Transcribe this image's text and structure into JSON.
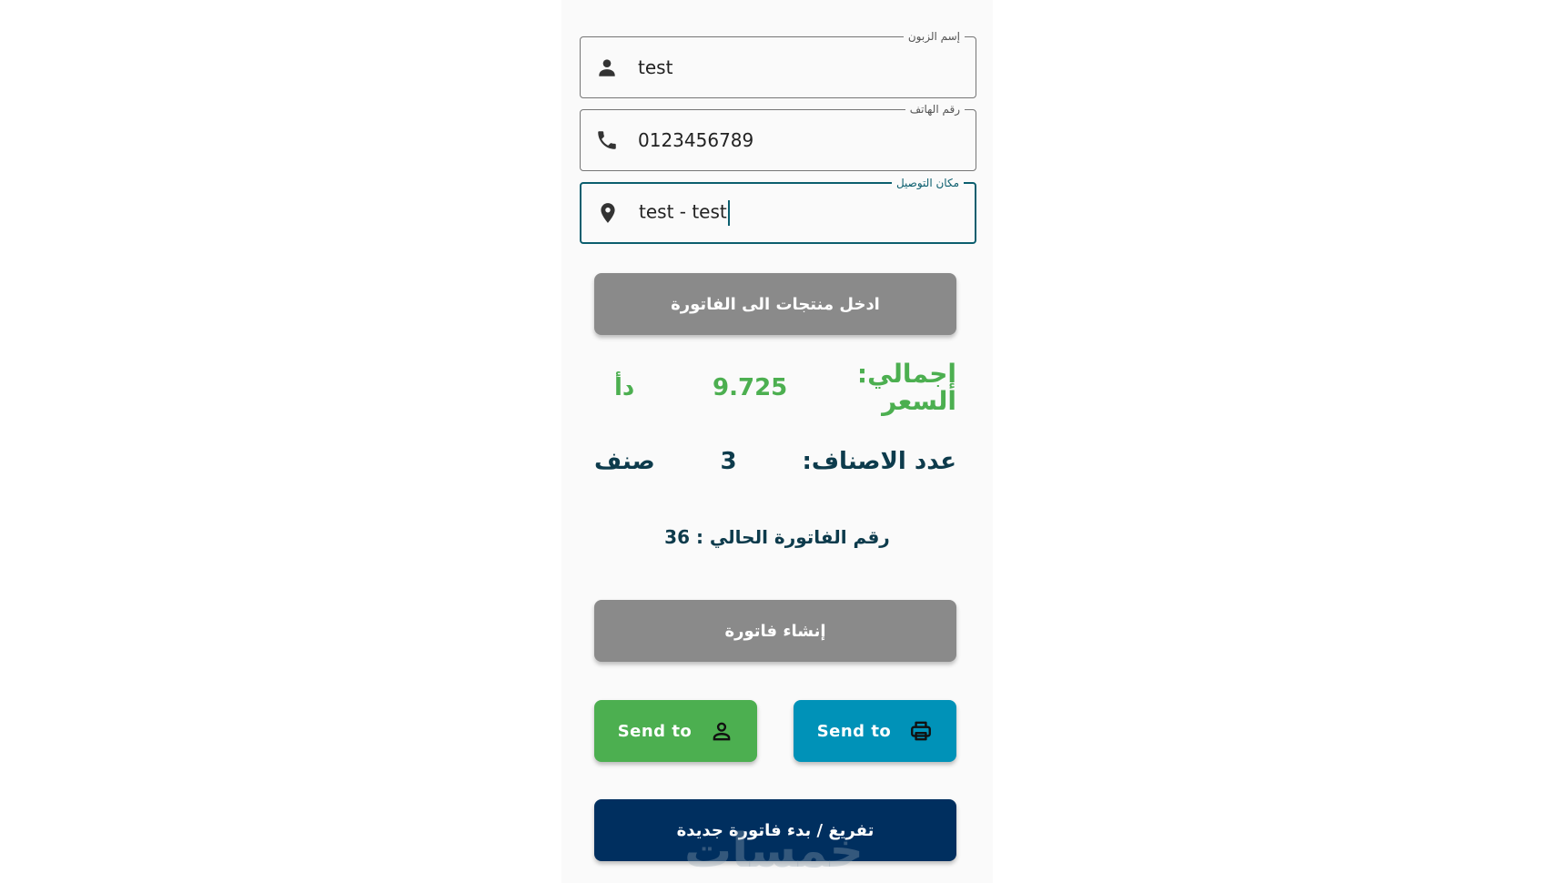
{
  "form": {
    "customer_name": {
      "label": "إسم الزبون",
      "value": "test",
      "icon": "person-icon"
    },
    "phone": {
      "label": "رقم الهاتف",
      "value": "0123456789",
      "icon": "phone-icon"
    },
    "delivery": {
      "label": "مكان التوصيل",
      "value": "test - test",
      "icon": "location-pin-icon"
    }
  },
  "buttons": {
    "add_products": "ادخل منتجات الى الفاتورة",
    "create_invoice": "إنشاء فاتورة",
    "send_customer": "Send to",
    "send_printer": "Send to",
    "clear_new": "تفريغ / بدء فاتورة جديدة"
  },
  "summary": {
    "total_label": "إجمالي: السعر",
    "total_value": "9.725",
    "currency": "دأ",
    "count_label": "عدد الاصناف:",
    "count_value": "3",
    "count_unit": "صنف",
    "invoice_number": "رقم الفاتورة الحالي : 36"
  },
  "watermark": "خمسات",
  "colors": {
    "green": "#4caf50",
    "teal": "#0092b8",
    "navy": "#002f5f",
    "gray": "#8a8a8a",
    "focus": "#0b5e6e"
  }
}
